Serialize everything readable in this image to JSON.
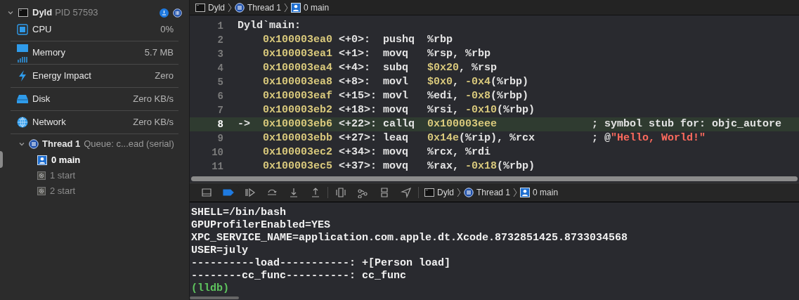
{
  "navigator": {
    "process": {
      "name": "Dyld",
      "pid": "PID 57593",
      "expanded": true
    },
    "gauges": [
      {
        "label": "CPU",
        "value": "0%"
      },
      {
        "label": "Memory",
        "value": "5.7 MB"
      },
      {
        "label": "Energy Impact",
        "value": "Zero"
      },
      {
        "label": "Disk",
        "value": "Zero KB/s"
      },
      {
        "label": "Network",
        "value": "Zero KB/s"
      }
    ],
    "thread": {
      "name": "Thread 1",
      "queue": "Queue: c...ead (serial)",
      "expanded": true,
      "frames": [
        {
          "label": "0 main",
          "kind": "user"
        },
        {
          "label": "1 start",
          "kind": "system"
        },
        {
          "label": "2 start",
          "kind": "system"
        }
      ]
    }
  },
  "jump_bar": [
    "Dyld",
    "Thread 1",
    "0 main"
  ],
  "disassembly": [
    {
      "number": "1",
      "current": false,
      "label": "Dyld`main:"
    },
    {
      "number": "2",
      "current": false,
      "address": "0x100003ea0",
      "offset": "<+0>:",
      "mnemonic": "pushq",
      "operands": [
        {
          "kind": "text",
          "text": "%rbp"
        }
      ]
    },
    {
      "number": "3",
      "current": false,
      "address": "0x100003ea1",
      "offset": "<+1>:",
      "mnemonic": "movq",
      "operands": [
        {
          "kind": "text",
          "text": "%rsp, %rbp"
        }
      ]
    },
    {
      "number": "4",
      "current": false,
      "address": "0x100003ea4",
      "offset": "<+4>:",
      "mnemonic": "subq",
      "operands": [
        {
          "kind": "num",
          "text": "$0x20"
        },
        {
          "kind": "text",
          "text": ", %rsp"
        }
      ]
    },
    {
      "number": "5",
      "current": false,
      "address": "0x100003ea8",
      "offset": "<+8>:",
      "mnemonic": "movl",
      "operands": [
        {
          "kind": "num",
          "text": "$0x0"
        },
        {
          "kind": "text",
          "text": ", "
        },
        {
          "kind": "num",
          "text": "-0x4"
        },
        {
          "kind": "text",
          "text": "(%rbp)"
        }
      ]
    },
    {
      "number": "6",
      "current": false,
      "address": "0x100003eaf",
      "offset": "<+15>:",
      "mnemonic": "movl",
      "operands": [
        {
          "kind": "text",
          "text": "%edi, "
        },
        {
          "kind": "num",
          "text": "-0x8"
        },
        {
          "kind": "text",
          "text": "(%rbp)"
        }
      ]
    },
    {
      "number": "7",
      "current": false,
      "address": "0x100003eb2",
      "offset": "<+18>:",
      "mnemonic": "movq",
      "operands": [
        {
          "kind": "text",
          "text": "%rsi, "
        },
        {
          "kind": "num",
          "text": "-0x10"
        },
        {
          "kind": "text",
          "text": "(%rbp)"
        }
      ]
    },
    {
      "number": "8",
      "current": true,
      "marker": "->",
      "address": "0x100003eb6",
      "offset": "<+22>:",
      "mnemonic": "callq",
      "operands": [
        {
          "kind": "num",
          "text": "0x100003eee"
        }
      ],
      "comment": [
        {
          "kind": "text",
          "text": "; symbol stub for: objc_autore"
        }
      ]
    },
    {
      "number": "9",
      "current": false,
      "address": "0x100003ebb",
      "offset": "<+27>:",
      "mnemonic": "leaq",
      "operands": [
        {
          "kind": "num",
          "text": "0x14e"
        },
        {
          "kind": "text",
          "text": "(%rip), %rcx"
        }
      ],
      "comment": [
        {
          "kind": "text",
          "text": "; @"
        },
        {
          "kind": "str",
          "text": "\"Hello, World!\""
        }
      ]
    },
    {
      "number": "10",
      "current": false,
      "address": "0x100003ec2",
      "offset": "<+34>:",
      "mnemonic": "movq",
      "operands": [
        {
          "kind": "text",
          "text": "%rcx, %rdi"
        }
      ]
    },
    {
      "number": "11",
      "current": false,
      "address": "0x100003ec5",
      "offset": "<+37>:",
      "mnemonic": "movq",
      "operands": [
        {
          "kind": "text",
          "text": "%rax, "
        },
        {
          "kind": "num",
          "text": "-0x18"
        },
        {
          "kind": "text",
          "text": "(%rbp)"
        }
      ]
    }
  ],
  "debug_bar": {
    "buttons": [
      {
        "kind": "hide",
        "active": false
      },
      {
        "kind": "breakpoints",
        "active": true
      },
      {
        "kind": "continue",
        "active": false
      },
      {
        "kind": "step_over",
        "active": false
      },
      {
        "kind": "step_into",
        "active": false
      },
      {
        "kind": "step_out",
        "active": false
      },
      {
        "kind": "view_debugger",
        "active": false
      },
      {
        "kind": "memory_graph",
        "active": false
      },
      {
        "kind": "environment",
        "active": false
      },
      {
        "kind": "location",
        "active": false
      }
    ],
    "jump_bar": [
      "Dyld",
      "Thread 1",
      "0 main"
    ]
  },
  "console": [
    {
      "kind": "output",
      "text": "SHELL=/bin/bash"
    },
    {
      "kind": "output",
      "text": "GPUProfilerEnabled=YES"
    },
    {
      "kind": "output",
      "text": "XPC_SERVICE_NAME=application.com.apple.dt.Xcode.8732851425.8733034568"
    },
    {
      "kind": "output",
      "text": "USER=july"
    },
    {
      "kind": "output",
      "text": "----------load-----------: +[Person load]"
    },
    {
      "kind": "output",
      "text": "--------cc_func----------: cc_func"
    },
    {
      "kind": "prompt",
      "text": "(lldb)"
    }
  ]
}
